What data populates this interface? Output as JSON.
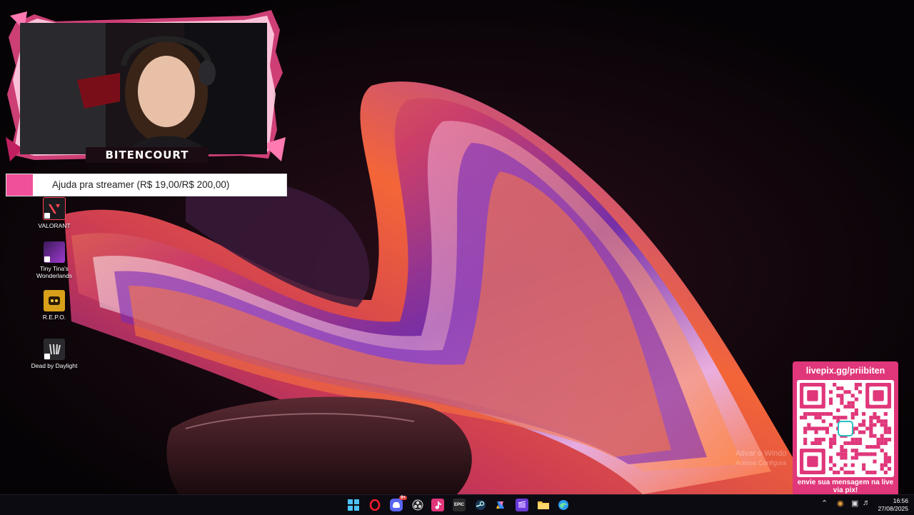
{
  "overlay": {
    "streamer_name": "BITENCOURT",
    "goal_text": "Ajuda pra streamer (R$ 19,00/R$ 200,00)",
    "goal_progress": 0.095,
    "accent_color": "#e0367a"
  },
  "desktop": {
    "icons": [
      {
        "label": "VALORANT",
        "icon": "valorant-icon"
      },
      {
        "label": "Tiny Tina's Wonderlands",
        "icon": "tiny-tinas-wonderlands-icon"
      },
      {
        "label": "R.E.P.O.",
        "icon": "repo-icon"
      },
      {
        "label": "Dead by Daylight",
        "icon": "dead-by-daylight-icon"
      }
    ]
  },
  "qr": {
    "url": "livepix.gg/priibiten",
    "message": "envie sua mensagem na live via pix!"
  },
  "watermark": {
    "title": "Ativar o Windo",
    "subtitle": "Acesse Configura"
  },
  "taskbar": {
    "apps": [
      "windows-start-icon",
      "opera-icon",
      "discord-icon",
      "obs-icon",
      "tiktok-icon",
      "epic-games-icon",
      "steam-icon",
      "copilot-icon",
      "clipchamp-icon",
      "file-explorer-icon",
      "edge-icon"
    ],
    "discord_badge": "9+",
    "epic_label": "EPIC",
    "time": "16:56",
    "date": "27/08/2025"
  }
}
